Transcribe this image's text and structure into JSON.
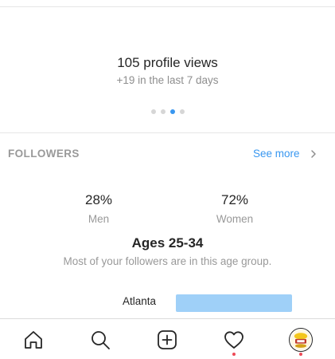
{
  "views": {
    "title": "105 profile views",
    "subtitle": "+19 in the last 7 days",
    "pager": {
      "count": 4,
      "active_index": 2
    }
  },
  "followers": {
    "header": "FOLLOWERS",
    "see_more": "See more",
    "men": {
      "value": "28%",
      "label": "Men"
    },
    "women": {
      "value": "72%",
      "label": "Women"
    },
    "age_title": "Ages 25-34",
    "age_subtitle": "Most of your followers are in this age group.",
    "top_city": {
      "name": "Atlanta"
    }
  },
  "tabbar": {
    "items": [
      {
        "icon": "home-icon"
      },
      {
        "icon": "search-icon"
      },
      {
        "icon": "add-icon"
      },
      {
        "icon": "heart-icon",
        "notification": true
      },
      {
        "icon": "avatar",
        "notification": true
      }
    ]
  },
  "colors": {
    "accent": "#3897f0",
    "city_bar": "#9fd0f8",
    "notification": "#ed4956",
    "muted_text": "#999999"
  }
}
